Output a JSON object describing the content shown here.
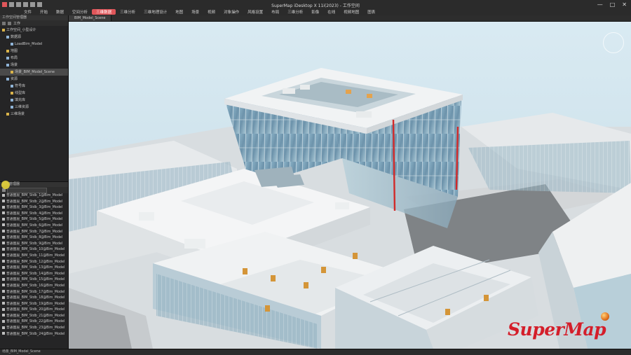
{
  "window": {
    "title": "SuperMap iDesktop X 11i(2023) - 工作空间"
  },
  "ribbon_tabs": [
    "文件",
    "开始",
    "数据",
    "空间分析",
    "三维数据",
    "三维分析",
    "三维地理设计",
    "地图",
    "场景",
    "视频",
    "对象操作",
    "风格设置",
    "布局",
    "三维分析",
    "影像",
    "在线",
    "视频地图",
    "图表"
  ],
  "ribbon_active_index": 4,
  "workspace_panel": {
    "header": "工作空间管理器",
    "tab": "工作",
    "items": [
      "工作空间_小型设计",
      "数据源",
      "LoadBim_Model",
      "地图",
      "布局",
      "场景",
      "场景_BIM_Model_Scene",
      "资源",
      "符号库",
      "线型库",
      "填充库",
      "三维资源",
      "三维场景"
    ],
    "selected_index": 6
  },
  "layers_panel": {
    "header": "图层管理器",
    "rows": [
      "普通图层_BIM_Stdb_1@Bim_Model",
      "普通图层_BIM_Stdb_2@Bim_Model",
      "普通图层_BIM_Stdb_3@Bim_Model",
      "普通图层_BIM_Stdb_4@Bim_Model",
      "普通图层_BIM_Stdb_5@Bim_Model",
      "普通图层_BIM_Stdb_6@Bim_Model",
      "普通图层_BIM_Stdb_7@Bim_Model",
      "普通图层_BIM_Stdb_8@Bim_Model",
      "普通图层_BIM_Stdb_9@Bim_Model",
      "普通图层_BIM_Stdb_10@Bim_Model",
      "普通图层_BIM_Stdb_11@Bim_Model",
      "普通图层_BIM_Stdb_12@Bim_Model",
      "普通图层_BIM_Stdb_13@Bim_Model",
      "普通图层_BIM_Stdb_14@Bim_Model",
      "普通图层_BIM_Stdb_15@Bim_Model",
      "普通图层_BIM_Stdb_16@Bim_Model",
      "普通图层_BIM_Stdb_17@Bim_Model",
      "普通图层_BIM_Stdb_18@Bim_Model",
      "普通图层_BIM_Stdb_19@Bim_Model",
      "普通图层_BIM_Stdb_20@Bim_Model",
      "普通图层_BIM_Stdb_21@Bim_Model",
      "普通图层_BIM_Stdb_22@Bim_Model",
      "普通图层_BIM_Stdb_23@Bim_Model",
      "普通图层_BIM_Stdb_24@Bim_Model"
    ]
  },
  "doc_tabs": [
    "BIM_Model_Scene"
  ],
  "status": {
    "left": "场景_BIM_Model_Scene",
    "right": ""
  },
  "brand": {
    "logo_text": "SuperMap",
    "logo_color": "#d41e2a"
  },
  "colors": {
    "accent": "#e0565a",
    "sky": "#cfe4ee",
    "glass": "#7aa2b8"
  }
}
